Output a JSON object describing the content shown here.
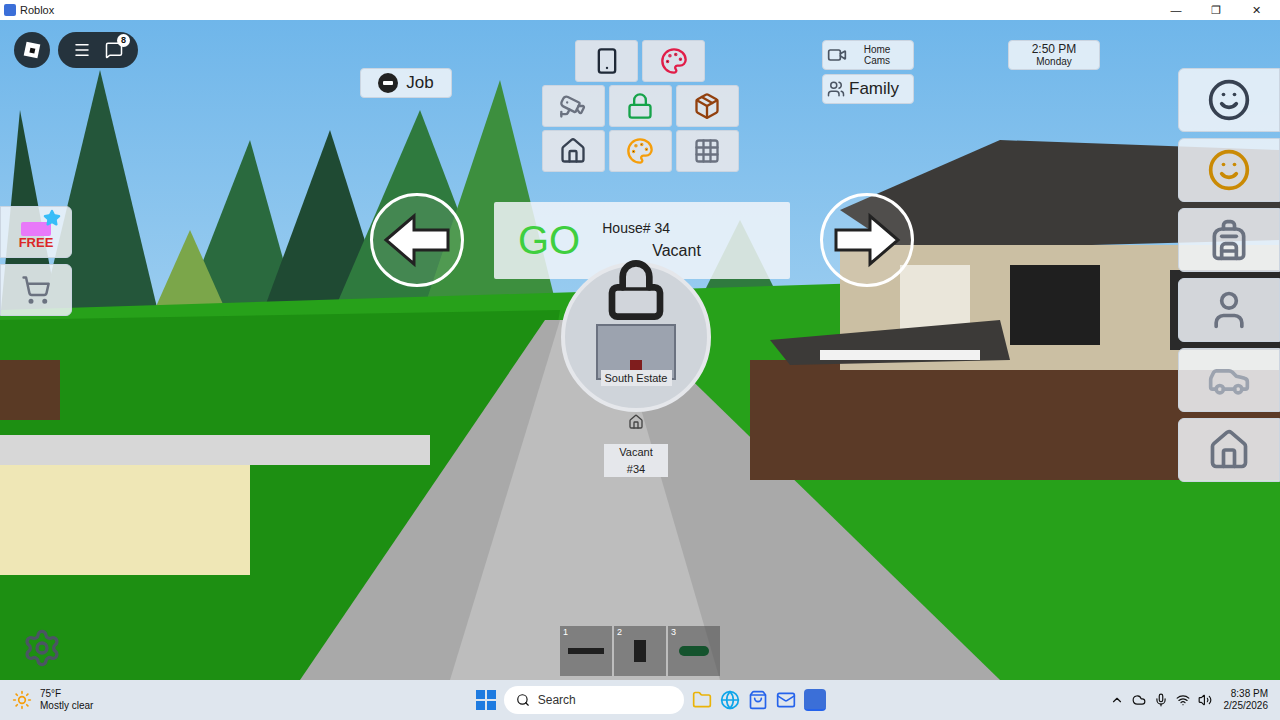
{
  "window": {
    "title": "Roblox",
    "controls": [
      "—",
      "❐",
      "✕"
    ]
  },
  "menu": {
    "chat_badge": "8"
  },
  "job_button": {
    "label": "Job"
  },
  "home_cams": {
    "label": "Home Cams"
  },
  "family_button": {
    "label": "Family"
  },
  "clock": {
    "time": "2:50 PM",
    "day": "Monday"
  },
  "promo": {
    "label": "FREE"
  },
  "house_selector": {
    "go": "GO",
    "house": "House# 34",
    "status": "Vacant"
  },
  "plot_sign": {
    "area": "South Estate",
    "status": "Vacant",
    "number": "#34",
    "locked": true
  },
  "hotbar": [
    {
      "slot": "1"
    },
    {
      "slot": "2"
    },
    {
      "slot": "3"
    }
  ],
  "taskbar": {
    "weather": {
      "temp": "75°F",
      "desc": "Mostly clear"
    },
    "search": {
      "placeholder": "Search"
    },
    "time": "8:38 PM",
    "date": "2/25/2026"
  }
}
